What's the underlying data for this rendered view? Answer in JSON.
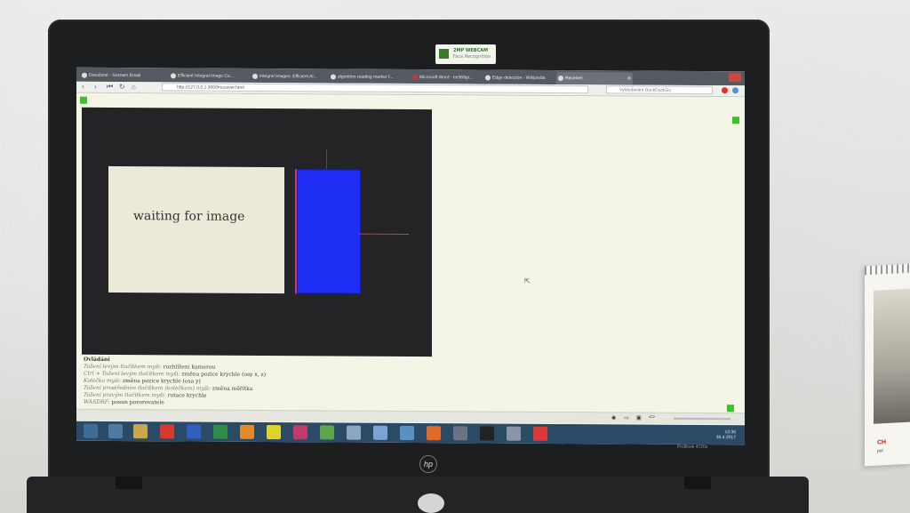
{
  "webcam_badge": {
    "line1": "2MP WEBCAM",
    "line2": "Face Recognition"
  },
  "browser": {
    "tabs": [
      {
        "label": "Doručené - Seznam Email"
      },
      {
        "label": "Efficient Integral Image Co..."
      },
      {
        "label": "Integral Images: Efficient Al..."
      },
      {
        "label": "algorithm reading marker f..."
      },
      {
        "label": "Microsoft Word - ee368gr..."
      },
      {
        "label": "Edge detection - Wikipedia"
      },
      {
        "label": "Receiver"
      }
    ],
    "url": "http://127.0.0.1:3000/receiver.html",
    "search_placeholder": "Vyhledávání DuckDuckGo"
  },
  "page": {
    "panel_text": "waiting for image",
    "instructions": {
      "title": "Ovládání",
      "lines": [
        {
          "action": "Tažení levým tlačítkem myši:",
          "effect": "rozhlížení kamerou"
        },
        {
          "action": "Ctrl + Tažení levým tlačítkem myši:",
          "effect": "změna pozice krychle (osy x, z)"
        },
        {
          "action": "Kolečko myši:",
          "effect": "změna pozice krychle (osa y)"
        },
        {
          "action": "Tažení prostředním tlačítkem (kolečkem) myši:",
          "effect": "změna měřítka"
        },
        {
          "action": "Tažení pravým tlačítkem myši:",
          "effect": "rotace krychle"
        },
        {
          "action": "WASDRF:",
          "effect": "posun pozorovatele"
        }
      ]
    }
  },
  "taskbar": {
    "clock_time": "13:36",
    "clock_date": "30.4.2017"
  },
  "laptop": {
    "model": "ProBook 4720s",
    "brand": "hp"
  },
  "calendar": {
    "text": "CH",
    "sub": "pol"
  },
  "colors": {
    "cube": "#1f2ff5",
    "canvas": "#242326",
    "marker": "#3cc12e",
    "taskbar": "#2a4a66"
  }
}
